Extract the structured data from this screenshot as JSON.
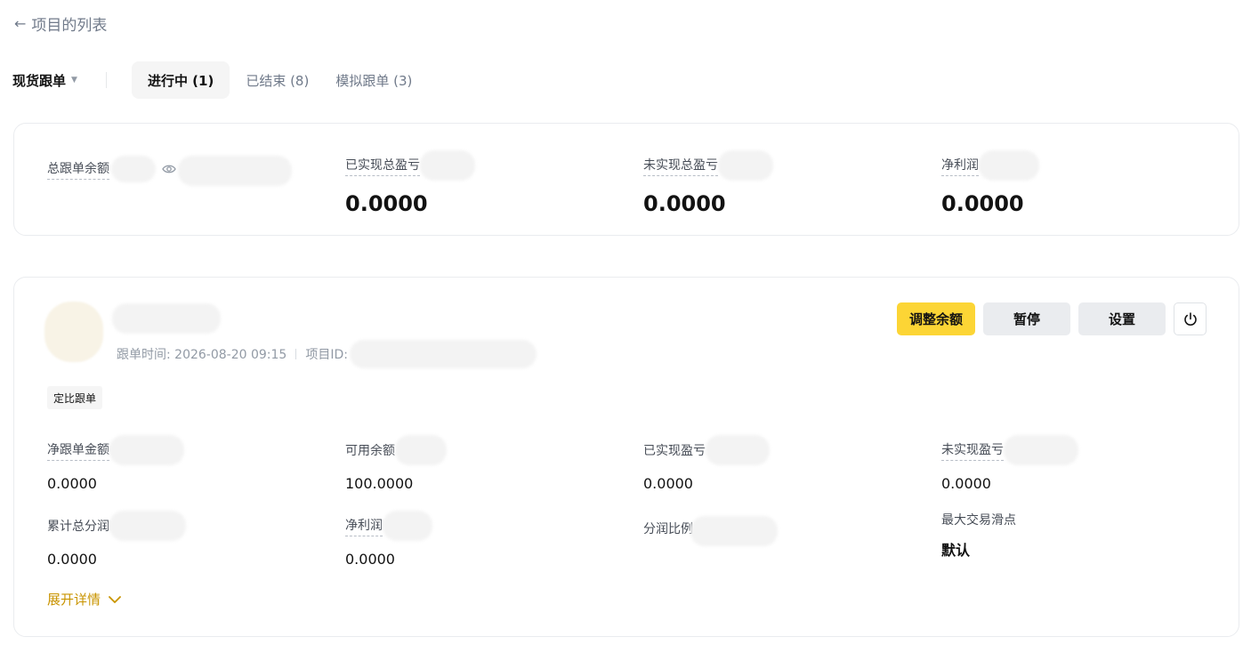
{
  "nav": {
    "back_arrow": "←",
    "back_label": "项目的列表"
  },
  "tabs": {
    "type_label": "现货跟单",
    "type_caret": "▼",
    "items": [
      {
        "label": "进行中 (1)",
        "active": true
      },
      {
        "label": "已结束 (8)",
        "active": false
      },
      {
        "label": "模拟跟单 (3)",
        "active": false
      }
    ]
  },
  "summary": {
    "total_balance_label": "总跟单余额",
    "realized_total_label": "已实现总盈亏",
    "realized_total_value": "0.0000",
    "unrealized_total_label": "未实现总盈亏",
    "unrealized_total_value": "0.0000",
    "net_profit_label": "净利润",
    "net_profit_value": "0.0000"
  },
  "project": {
    "time_label": "跟单时间: 2026-08-20 09:15",
    "id_label": "项目ID:",
    "tag": "定比跟单",
    "buttons": {
      "adjust": "调整余额",
      "pause": "暂停",
      "settings": "设置"
    },
    "stats": {
      "net_amount_label": "净跟单金额",
      "net_amount_value": "0.0000",
      "available_label": "可用余额",
      "available_value": "100.0000",
      "realized_label": "已实现盈亏",
      "realized_value": "0.0000",
      "unrealized_label": "未实现盈亏",
      "unrealized_value": "0.0000",
      "total_share_label": "累计总分润",
      "total_share_value": "0.0000",
      "net_profit_label": "净利润",
      "net_profit_value": "0.0000",
      "share_ratio_label": "分润比例",
      "max_slippage_label": "最大交易滑点",
      "max_slippage_value": "默认"
    },
    "expand_label": "展开详情"
  },
  "colors": {
    "accent": "#fcd535",
    "link": "#c99400",
    "muted": "#707a8a"
  },
  "icons": {
    "eye": "eye-icon",
    "power": "power-icon",
    "chevron": "chevron-down-icon",
    "back": "arrow-left-icon"
  }
}
